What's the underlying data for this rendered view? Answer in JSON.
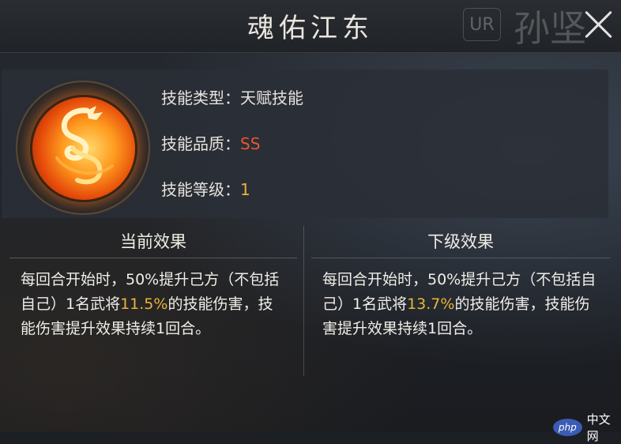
{
  "header": {
    "title": "魂佑江东",
    "rarity_badge": "UR",
    "hero_name": "孙坚"
  },
  "skill": {
    "icon": "dragon-icon",
    "type_label": "技能类型：",
    "type_value": "天赋技能",
    "quality_label": "技能品质：",
    "quality_value": "SS",
    "level_label": "技能等级：",
    "level_value": "1"
  },
  "effects": {
    "current": {
      "title": "当前效果",
      "text_before": "每回合开始时，50%提升己方（不包括自己）1名武将",
      "highlight": "11.5%",
      "text_after": "的技能伤害，技能伤害提升效果持续1回合。"
    },
    "next": {
      "title": "下级效果",
      "text_before": "每回合开始时，50%提升己方（不包括自己）1名武将",
      "highlight": "13.7%",
      "text_after": "的技能伤害，技能伤害提升效果持续1回合。"
    }
  },
  "watermark": {
    "logo": "php",
    "text": "中文网"
  },
  "colors": {
    "quality": "#e4572e",
    "highlight": "#e8b537"
  }
}
